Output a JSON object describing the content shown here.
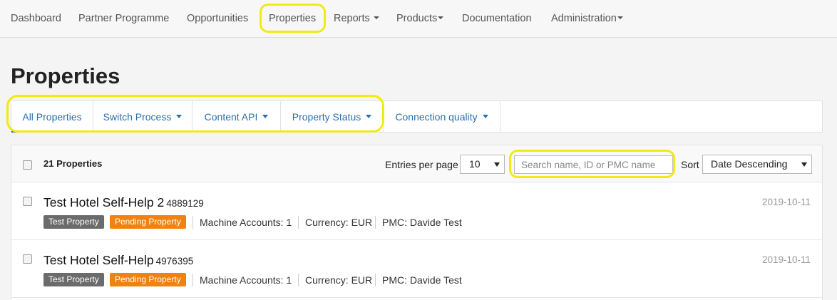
{
  "nav": {
    "items": [
      {
        "label": "Dashboard"
      },
      {
        "label": "Partner Programme"
      },
      {
        "label": "Opportunities"
      },
      {
        "label": "Properties"
      },
      {
        "label": "Reports"
      },
      {
        "label": "Products"
      },
      {
        "label": "Documentation"
      },
      {
        "label": "Administration"
      }
    ]
  },
  "page": {
    "title": "Properties"
  },
  "tabs": [
    {
      "label": "All Properties"
    },
    {
      "label": "Switch Process"
    },
    {
      "label": "Content API"
    },
    {
      "label": "Property Status"
    },
    {
      "label": "Connection quality"
    }
  ],
  "list": {
    "count_label": "21 Properties",
    "entries_label": "Entries per page",
    "entries_value": "10",
    "search_placeholder": "Search name, ID or PMC name",
    "sort_label": "Sort",
    "sort_value": "Date Descending"
  },
  "rows": [
    {
      "name": "Test Hotel Self-Help 2",
      "id": "4889129",
      "date": "2019-10-11",
      "badges": [
        "Test Property",
        "Pending Property"
      ],
      "machine_accounts": "Machine Accounts: 1",
      "currency": "Currency: EUR",
      "pmc": "PMC: Davide Test"
    },
    {
      "name": "Test Hotel Self-Help",
      "id": "4976395",
      "date": "2019-10-11",
      "badges": [
        "Test Property",
        "Pending Property"
      ],
      "machine_accounts": "Machine Accounts: 1",
      "currency": "Currency: EUR",
      "pmc": "PMC: Davide Test"
    }
  ],
  "colors": {
    "accent": "#2a6fb0",
    "badge_test": "#6b6b6b",
    "badge_pending": "#f0820f",
    "highlight": "#f2ea12"
  }
}
